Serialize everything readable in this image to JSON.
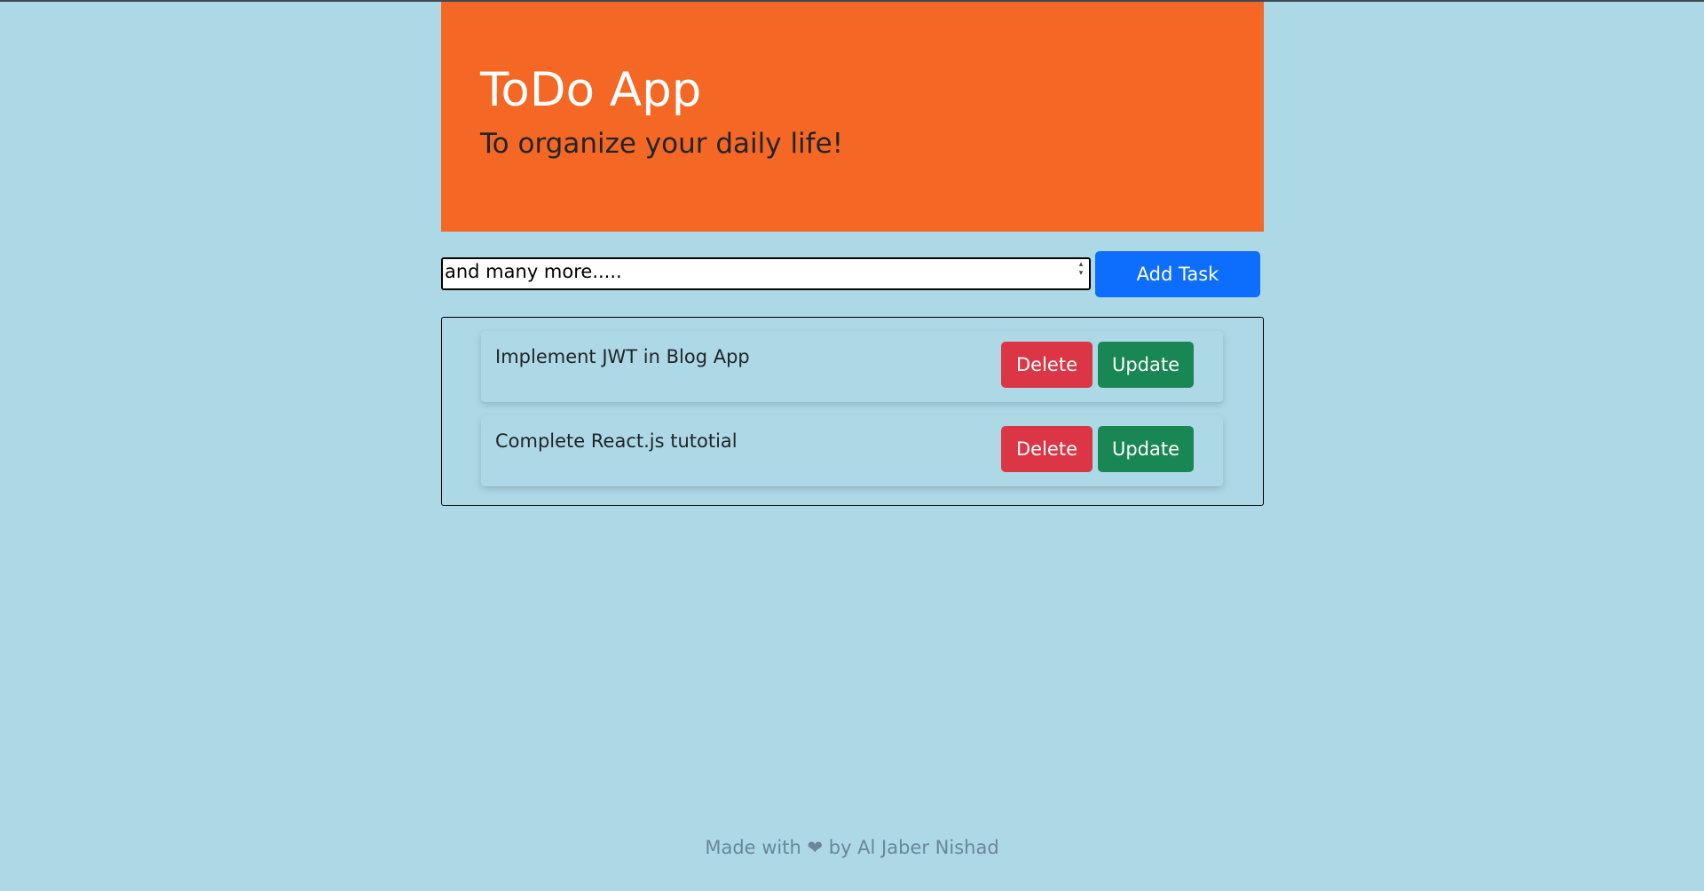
{
  "header": {
    "title": "ToDo App",
    "subtitle": "To organize your daily life!"
  },
  "input": {
    "value": "and many more.....",
    "add_button_label": "Add Task"
  },
  "tasks": [
    {
      "text": "Implement JWT in Blog App",
      "delete_label": "Delete",
      "update_label": "Update"
    },
    {
      "text": "Complete React.js tutotial",
      "delete_label": "Delete",
      "update_label": "Update"
    }
  ],
  "footer": {
    "text": "Made with ❤ by Al Jaber Nishad"
  },
  "colors": {
    "background": "#add8e6",
    "hero": "#f46724",
    "primary": "#0d6efd",
    "danger": "#dc3545",
    "success": "#198754"
  }
}
